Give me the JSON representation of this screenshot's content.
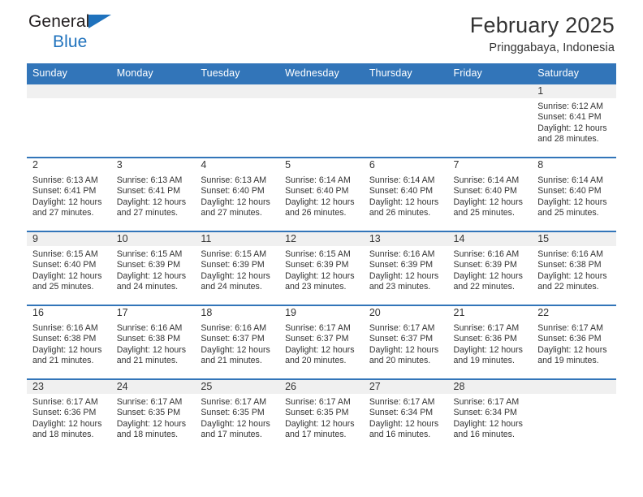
{
  "brand": {
    "name_part1": "General",
    "name_part2": "Blue",
    "accent_color": "#1f72bd"
  },
  "header": {
    "title": "February 2025",
    "subtitle": "Pringgabaya, Indonesia"
  },
  "calendar": {
    "header_bg": "#3275b9",
    "header_text_color": "#ffffff",
    "weekday_headers": [
      "Sunday",
      "Monday",
      "Tuesday",
      "Wednesday",
      "Thursday",
      "Friday",
      "Saturday"
    ],
    "weeks": [
      [
        {
          "day": "",
          "sunrise": "",
          "sunset": "",
          "daylight1": "",
          "daylight2": ""
        },
        {
          "day": "",
          "sunrise": "",
          "sunset": "",
          "daylight1": "",
          "daylight2": ""
        },
        {
          "day": "",
          "sunrise": "",
          "sunset": "",
          "daylight1": "",
          "daylight2": ""
        },
        {
          "day": "",
          "sunrise": "",
          "sunset": "",
          "daylight1": "",
          "daylight2": ""
        },
        {
          "day": "",
          "sunrise": "",
          "sunset": "",
          "daylight1": "",
          "daylight2": ""
        },
        {
          "day": "",
          "sunrise": "",
          "sunset": "",
          "daylight1": "",
          "daylight2": ""
        },
        {
          "day": "1",
          "sunrise": "Sunrise: 6:12 AM",
          "sunset": "Sunset: 6:41 PM",
          "daylight1": "Daylight: 12 hours",
          "daylight2": "and 28 minutes."
        }
      ],
      [
        {
          "day": "2",
          "sunrise": "Sunrise: 6:13 AM",
          "sunset": "Sunset: 6:41 PM",
          "daylight1": "Daylight: 12 hours",
          "daylight2": "and 27 minutes."
        },
        {
          "day": "3",
          "sunrise": "Sunrise: 6:13 AM",
          "sunset": "Sunset: 6:41 PM",
          "daylight1": "Daylight: 12 hours",
          "daylight2": "and 27 minutes."
        },
        {
          "day": "4",
          "sunrise": "Sunrise: 6:13 AM",
          "sunset": "Sunset: 6:40 PM",
          "daylight1": "Daylight: 12 hours",
          "daylight2": "and 27 minutes."
        },
        {
          "day": "5",
          "sunrise": "Sunrise: 6:14 AM",
          "sunset": "Sunset: 6:40 PM",
          "daylight1": "Daylight: 12 hours",
          "daylight2": "and 26 minutes."
        },
        {
          "day": "6",
          "sunrise": "Sunrise: 6:14 AM",
          "sunset": "Sunset: 6:40 PM",
          "daylight1": "Daylight: 12 hours",
          "daylight2": "and 26 minutes."
        },
        {
          "day": "7",
          "sunrise": "Sunrise: 6:14 AM",
          "sunset": "Sunset: 6:40 PM",
          "daylight1": "Daylight: 12 hours",
          "daylight2": "and 25 minutes."
        },
        {
          "day": "8",
          "sunrise": "Sunrise: 6:14 AM",
          "sunset": "Sunset: 6:40 PM",
          "daylight1": "Daylight: 12 hours",
          "daylight2": "and 25 minutes."
        }
      ],
      [
        {
          "day": "9",
          "sunrise": "Sunrise: 6:15 AM",
          "sunset": "Sunset: 6:40 PM",
          "daylight1": "Daylight: 12 hours",
          "daylight2": "and 25 minutes."
        },
        {
          "day": "10",
          "sunrise": "Sunrise: 6:15 AM",
          "sunset": "Sunset: 6:39 PM",
          "daylight1": "Daylight: 12 hours",
          "daylight2": "and 24 minutes."
        },
        {
          "day": "11",
          "sunrise": "Sunrise: 6:15 AM",
          "sunset": "Sunset: 6:39 PM",
          "daylight1": "Daylight: 12 hours",
          "daylight2": "and 24 minutes."
        },
        {
          "day": "12",
          "sunrise": "Sunrise: 6:15 AM",
          "sunset": "Sunset: 6:39 PM",
          "daylight1": "Daylight: 12 hours",
          "daylight2": "and 23 minutes."
        },
        {
          "day": "13",
          "sunrise": "Sunrise: 6:16 AM",
          "sunset": "Sunset: 6:39 PM",
          "daylight1": "Daylight: 12 hours",
          "daylight2": "and 23 minutes."
        },
        {
          "day": "14",
          "sunrise": "Sunrise: 6:16 AM",
          "sunset": "Sunset: 6:39 PM",
          "daylight1": "Daylight: 12 hours",
          "daylight2": "and 22 minutes."
        },
        {
          "day": "15",
          "sunrise": "Sunrise: 6:16 AM",
          "sunset": "Sunset: 6:38 PM",
          "daylight1": "Daylight: 12 hours",
          "daylight2": "and 22 minutes."
        }
      ],
      [
        {
          "day": "16",
          "sunrise": "Sunrise: 6:16 AM",
          "sunset": "Sunset: 6:38 PM",
          "daylight1": "Daylight: 12 hours",
          "daylight2": "and 21 minutes."
        },
        {
          "day": "17",
          "sunrise": "Sunrise: 6:16 AM",
          "sunset": "Sunset: 6:38 PM",
          "daylight1": "Daylight: 12 hours",
          "daylight2": "and 21 minutes."
        },
        {
          "day": "18",
          "sunrise": "Sunrise: 6:16 AM",
          "sunset": "Sunset: 6:37 PM",
          "daylight1": "Daylight: 12 hours",
          "daylight2": "and 21 minutes."
        },
        {
          "day": "19",
          "sunrise": "Sunrise: 6:17 AM",
          "sunset": "Sunset: 6:37 PM",
          "daylight1": "Daylight: 12 hours",
          "daylight2": "and 20 minutes."
        },
        {
          "day": "20",
          "sunrise": "Sunrise: 6:17 AM",
          "sunset": "Sunset: 6:37 PM",
          "daylight1": "Daylight: 12 hours",
          "daylight2": "and 20 minutes."
        },
        {
          "day": "21",
          "sunrise": "Sunrise: 6:17 AM",
          "sunset": "Sunset: 6:36 PM",
          "daylight1": "Daylight: 12 hours",
          "daylight2": "and 19 minutes."
        },
        {
          "day": "22",
          "sunrise": "Sunrise: 6:17 AM",
          "sunset": "Sunset: 6:36 PM",
          "daylight1": "Daylight: 12 hours",
          "daylight2": "and 19 minutes."
        }
      ],
      [
        {
          "day": "23",
          "sunrise": "Sunrise: 6:17 AM",
          "sunset": "Sunset: 6:36 PM",
          "daylight1": "Daylight: 12 hours",
          "daylight2": "and 18 minutes."
        },
        {
          "day": "24",
          "sunrise": "Sunrise: 6:17 AM",
          "sunset": "Sunset: 6:35 PM",
          "daylight1": "Daylight: 12 hours",
          "daylight2": "and 18 minutes."
        },
        {
          "day": "25",
          "sunrise": "Sunrise: 6:17 AM",
          "sunset": "Sunset: 6:35 PM",
          "daylight1": "Daylight: 12 hours",
          "daylight2": "and 17 minutes."
        },
        {
          "day": "26",
          "sunrise": "Sunrise: 6:17 AM",
          "sunset": "Sunset: 6:35 PM",
          "daylight1": "Daylight: 12 hours",
          "daylight2": "and 17 minutes."
        },
        {
          "day": "27",
          "sunrise": "Sunrise: 6:17 AM",
          "sunset": "Sunset: 6:34 PM",
          "daylight1": "Daylight: 12 hours",
          "daylight2": "and 16 minutes."
        },
        {
          "day": "28",
          "sunrise": "Sunrise: 6:17 AM",
          "sunset": "Sunset: 6:34 PM",
          "daylight1": "Daylight: 12 hours",
          "daylight2": "and 16 minutes."
        },
        {
          "day": "",
          "sunrise": "",
          "sunset": "",
          "daylight1": "",
          "daylight2": ""
        }
      ]
    ]
  }
}
